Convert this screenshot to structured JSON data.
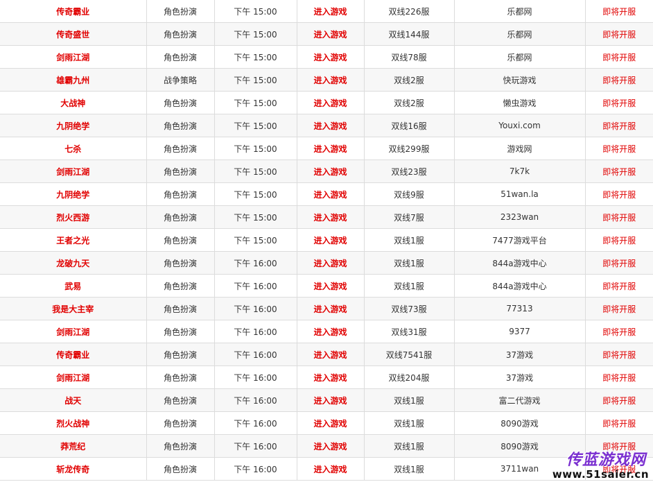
{
  "rows": [
    {
      "name": "传奇霸业",
      "category": "角色扮演",
      "time": "下午 15:00",
      "enter": "进入游戏",
      "server": "双线226服",
      "platform": "乐都网",
      "status": "即将开服"
    },
    {
      "name": "传奇盛世",
      "category": "角色扮演",
      "time": "下午 15:00",
      "enter": "进入游戏",
      "server": "双线144服",
      "platform": "乐都网",
      "status": "即将开服"
    },
    {
      "name": "剑雨江湖",
      "category": "角色扮演",
      "time": "下午 15:00",
      "enter": "进入游戏",
      "server": "双线78服",
      "platform": "乐都网",
      "status": "即将开服"
    },
    {
      "name": "雄霸九州",
      "category": "战争策略",
      "time": "下午 15:00",
      "enter": "进入游戏",
      "server": "双线2服",
      "platform": "快玩游戏",
      "status": "即将开服"
    },
    {
      "name": "大战神",
      "category": "角色扮演",
      "time": "下午 15:00",
      "enter": "进入游戏",
      "server": "双线2服",
      "platform": "懒虫游戏",
      "status": "即将开服"
    },
    {
      "name": "九阴绝学",
      "category": "角色扮演",
      "time": "下午 15:00",
      "enter": "进入游戏",
      "server": "双线16服",
      "platform": "Youxi.com",
      "status": "即将开服"
    },
    {
      "name": "七杀",
      "category": "角色扮演",
      "time": "下午 15:00",
      "enter": "进入游戏",
      "server": "双线299服",
      "platform": "游戏网",
      "status": "即将开服"
    },
    {
      "name": "剑雨江湖",
      "category": "角色扮演",
      "time": "下午 15:00",
      "enter": "进入游戏",
      "server": "双线23服",
      "platform": "7k7k",
      "status": "即将开服"
    },
    {
      "name": "九阴绝学",
      "category": "角色扮演",
      "time": "下午 15:00",
      "enter": "进入游戏",
      "server": "双线9服",
      "platform": "51wan.la",
      "status": "即将开服"
    },
    {
      "name": "烈火西游",
      "category": "角色扮演",
      "time": "下午 15:00",
      "enter": "进入游戏",
      "server": "双线7服",
      "platform": "2323wan",
      "status": "即将开服"
    },
    {
      "name": "王者之光",
      "category": "角色扮演",
      "time": "下午 15:00",
      "enter": "进入游戏",
      "server": "双线1服",
      "platform": "7477游戏平台",
      "status": "即将开服"
    },
    {
      "name": "龙破九天",
      "category": "角色扮演",
      "time": "下午 16:00",
      "enter": "进入游戏",
      "server": "双线1服",
      "platform": "844a游戏中心",
      "status": "即将开服"
    },
    {
      "name": "武易",
      "category": "角色扮演",
      "time": "下午 16:00",
      "enter": "进入游戏",
      "server": "双线1服",
      "platform": "844a游戏中心",
      "status": "即将开服"
    },
    {
      "name": "我是大主宰",
      "category": "角色扮演",
      "time": "下午 16:00",
      "enter": "进入游戏",
      "server": "双线73服",
      "platform": "77313",
      "status": "即将开服"
    },
    {
      "name": "剑雨江湖",
      "category": "角色扮演",
      "time": "下午 16:00",
      "enter": "进入游戏",
      "server": "双线31服",
      "platform": "9377",
      "status": "即将开服"
    },
    {
      "name": "传奇霸业",
      "category": "角色扮演",
      "time": "下午 16:00",
      "enter": "进入游戏",
      "server": "双线7541服",
      "platform": "37游戏",
      "status": "即将开服"
    },
    {
      "name": "剑雨江湖",
      "category": "角色扮演",
      "time": "下午 16:00",
      "enter": "进入游戏",
      "server": "双线204服",
      "platform": "37游戏",
      "status": "即将开服"
    },
    {
      "name": "战天",
      "category": "角色扮演",
      "time": "下午 16:00",
      "enter": "进入游戏",
      "server": "双线1服",
      "platform": "富二代游戏",
      "status": "即将开服"
    },
    {
      "name": "烈火战神",
      "category": "角色扮演",
      "time": "下午 16:00",
      "enter": "进入游戏",
      "server": "双线1服",
      "platform": "8090游戏",
      "status": "即将开服"
    },
    {
      "name": "莽荒纪",
      "category": "角色扮演",
      "time": "下午 16:00",
      "enter": "进入游戏",
      "server": "双线1服",
      "platform": "8090游戏",
      "status": "即将开服"
    },
    {
      "name": "斩龙传奇",
      "category": "角色扮演",
      "time": "下午 16:00",
      "enter": "进入游戏",
      "server": "双线1服",
      "platform": "3711wan",
      "status": "即将开服"
    }
  ],
  "watermark": {
    "logo_text": "传蓝游戏网",
    "url_text": "www.51saier.cn"
  },
  "colors": {
    "accent_red": "#e10000",
    "row_alt": "#f7f7f7",
    "border": "#dcdcdc"
  }
}
